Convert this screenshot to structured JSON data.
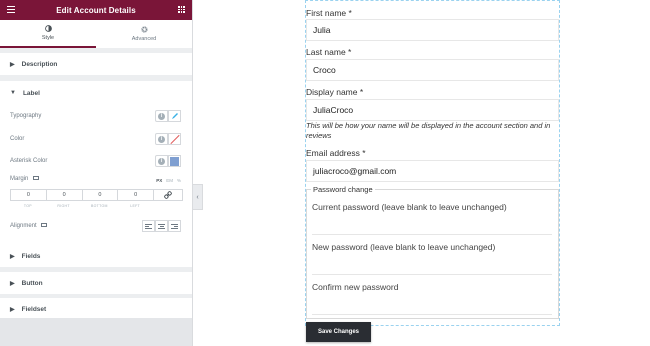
{
  "panel": {
    "title": "Edit Account Details",
    "tabs": [
      {
        "label": "Style",
        "icon": "contrast-icon",
        "active": true
      },
      {
        "label": "Advanced",
        "icon": "gear-icon",
        "active": false
      }
    ],
    "sections": {
      "description": "Description",
      "label": "Label",
      "fields": "Fields",
      "button": "Button",
      "fieldset": "Fieldset"
    },
    "label_controls": {
      "typography": "Typography",
      "color": "Color",
      "asterisk_color": "Asterisk Color",
      "asterisk_color_value": "#7f9fd1",
      "margin": "Margin",
      "units": [
        "PX",
        "EM",
        "%"
      ],
      "margin_values": [
        "0",
        "0",
        "0",
        "0"
      ],
      "margin_sides": [
        "TOP",
        "RIGHT",
        "BOTTOM",
        "LEFT"
      ],
      "alignment": "Alignment"
    },
    "accent_color": "#7a1538"
  },
  "form": {
    "first_name_label": "First name *",
    "first_name_value": "Julia",
    "last_name_label": "Last name *",
    "last_name_value": "Croco",
    "display_name_label": "Display name *",
    "display_name_value": "JuliaCroco",
    "display_name_hint": "This will be how your name will be displayed in the account section and in reviews",
    "email_label": "Email address *",
    "email_value": "juliacroco@gmail.com",
    "password_legend": "Password change",
    "current_password_label": "Current password (leave blank to leave unchanged)",
    "new_password_label": "New password (leave blank to leave unchanged)",
    "confirm_password_label": "Confirm new password",
    "save_label": "Save Changes"
  }
}
